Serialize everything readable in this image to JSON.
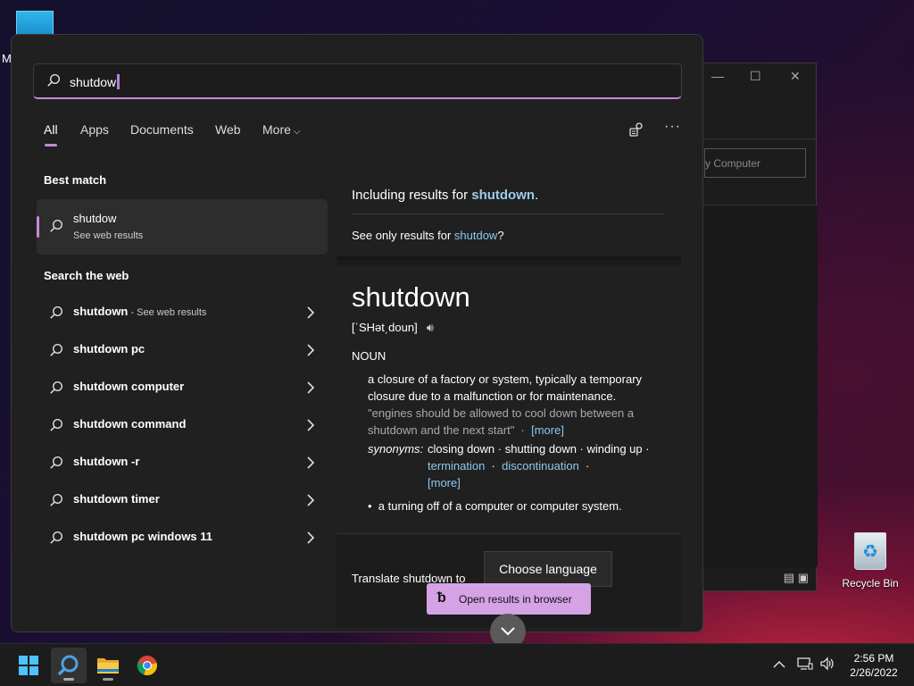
{
  "desktop": {
    "partial_label": "M",
    "recycle_bin": "Recycle Bin"
  },
  "background_window": {
    "address_text": "y Computer"
  },
  "search": {
    "query": "shutdow",
    "tabs": [
      {
        "label": "All",
        "active": true
      },
      {
        "label": "Apps",
        "active": false
      },
      {
        "label": "Documents",
        "active": false
      },
      {
        "label": "Web",
        "active": false
      },
      {
        "label": "More",
        "active": false
      }
    ],
    "best_match": {
      "heading": "Best match",
      "title": "shutdow",
      "subtitle": "See web results"
    },
    "web_section": {
      "heading": "Search the web",
      "items": [
        {
          "text": "shutdown",
          "sub": " - See web results"
        },
        {
          "text": "shutdown pc",
          "sub": ""
        },
        {
          "text": "shutdown computer",
          "sub": ""
        },
        {
          "text": "shutdown command",
          "sub": ""
        },
        {
          "text": "shutdown -r",
          "sub": ""
        },
        {
          "text": "shutdown timer",
          "sub": ""
        },
        {
          "text": "shutdown pc windows 11",
          "sub": ""
        }
      ]
    },
    "results": {
      "including_prefix": "Including results for ",
      "including_term": "shutdown",
      "including_suffix": ".",
      "see_only_prefix": "See only results for ",
      "see_only_term": "shutdow",
      "see_only_suffix": "?"
    },
    "dictionary": {
      "word": "shutdown",
      "pronunciation": "[ˈSHət͵doun]",
      "part_of_speech": "NOUN",
      "definition_1": "a closure of a factory or system, typically a temporary closure due to a malfunction or for maintenance.",
      "example": "\"engines should be allowed to cool down between a shutdown and the next start\"",
      "example_more": "[more]",
      "synonyms_label": "synonyms:",
      "synonyms_plain": "closing down · shutting down · winding up · ",
      "synonym_link_1": "termination",
      "synonym_link_2": "discontinuation",
      "synonyms_more": "[more]",
      "definition_2": "a turning off of a computer or computer system."
    },
    "translate": {
      "label": "Translate shutdown to",
      "button": "Choose language"
    },
    "open_browser": "Open results in browser"
  },
  "taskbar": {
    "time": "2:56 PM",
    "date": "2/26/2022"
  },
  "colors": {
    "accent": "#c38ad8",
    "link": "#8ec8f0",
    "open_button": "#d6a2e6"
  }
}
